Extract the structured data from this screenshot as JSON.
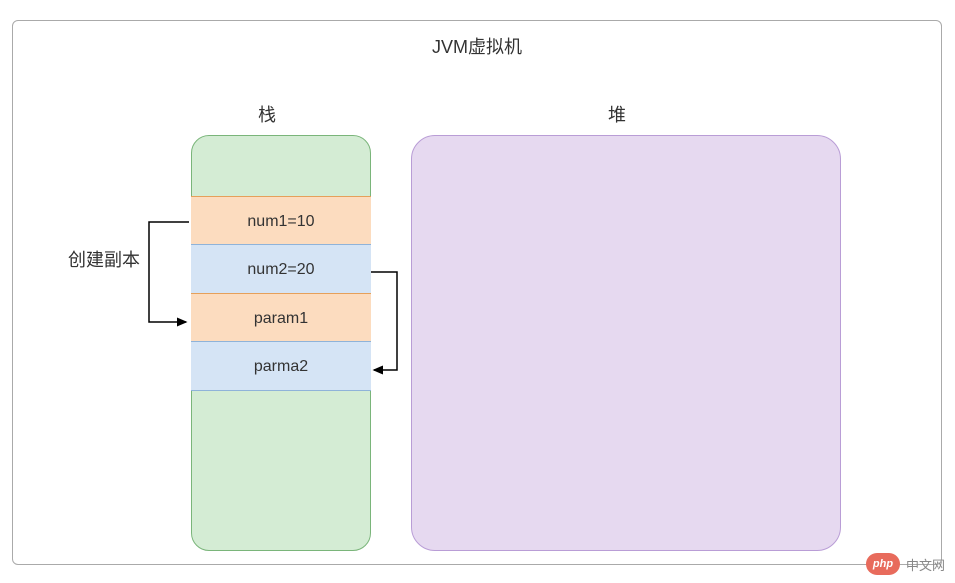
{
  "title": "JVM虚拟机",
  "stack": {
    "label": "栈",
    "cells": [
      {
        "text": "num1=10",
        "color": "orange"
      },
      {
        "text": "num2=20",
        "color": "blue"
      },
      {
        "text": "param1",
        "color": "orange"
      },
      {
        "text": "parma2",
        "color": "blue"
      }
    ]
  },
  "heap": {
    "label": "堆"
  },
  "copy_label": "创建副本",
  "watermark": {
    "logo": "php",
    "text": "中文网"
  },
  "arrows": [
    {
      "from": "num1",
      "to": "param1",
      "side": "left"
    },
    {
      "from": "num2",
      "to": "parma2",
      "side": "right"
    }
  ]
}
